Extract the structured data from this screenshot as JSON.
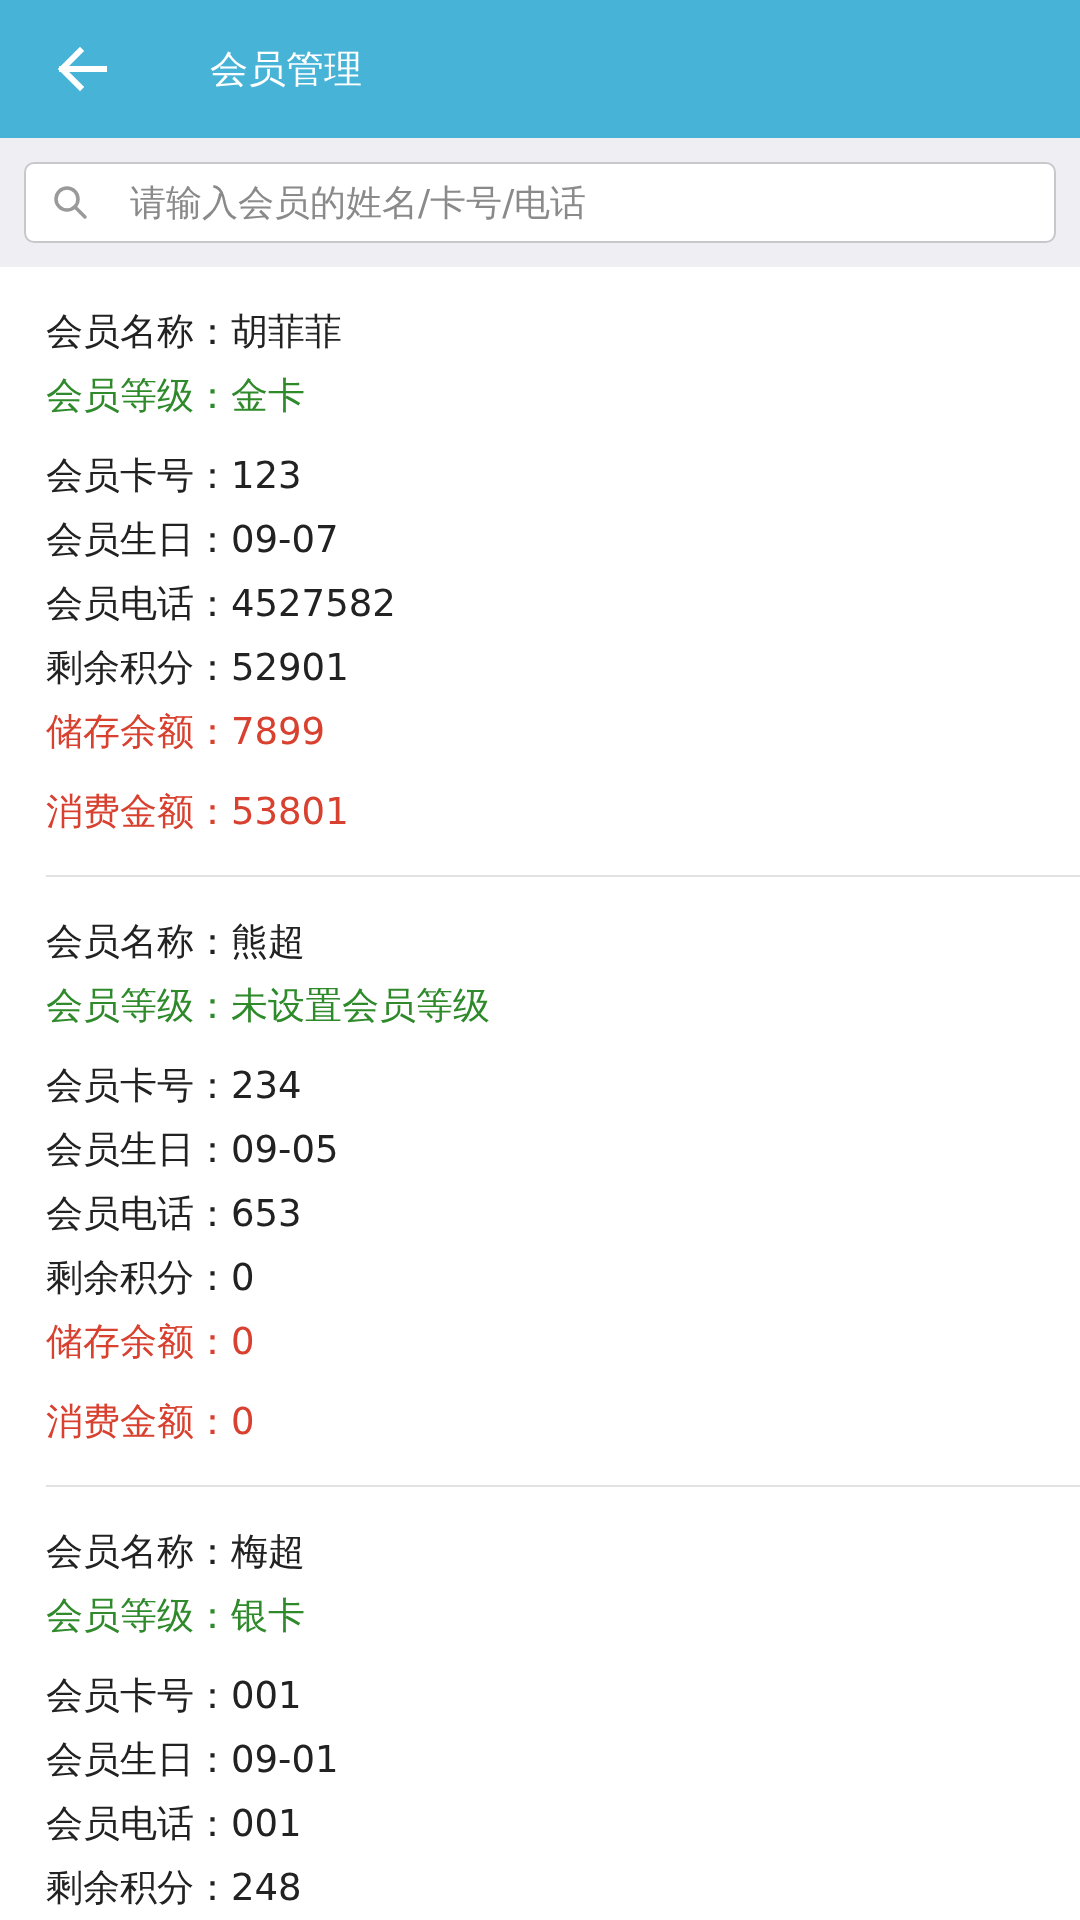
{
  "header": {
    "title": "会员管理"
  },
  "search": {
    "placeholder": "请输入会员的姓名/卡号/电话"
  },
  "members": [
    {
      "fields": [
        {
          "kind": "name",
          "label": "会员名称：",
          "value": "胡菲菲"
        },
        {
          "kind": "level",
          "label": "会员等级：",
          "value": "金卡"
        },
        {
          "kind": "info",
          "label": "会员卡号：",
          "value": "123"
        },
        {
          "kind": "info",
          "label": "会员生日：",
          "value": "09-07"
        },
        {
          "kind": "info",
          "label": "会员电话：",
          "value": "4527582"
        },
        {
          "kind": "info",
          "label": "剩余积分：",
          "value": "52901"
        },
        {
          "kind": "balance",
          "label": "储存余额：",
          "value": "7899"
        },
        {
          "kind": "spent",
          "label": "消费金额：",
          "value": "53801"
        }
      ]
    },
    {
      "fields": [
        {
          "kind": "name",
          "label": "会员名称：",
          "value": "熊超"
        },
        {
          "kind": "level",
          "label": "会员等级：",
          "value": "未设置会员等级"
        },
        {
          "kind": "info",
          "label": "会员卡号：",
          "value": "234"
        },
        {
          "kind": "info",
          "label": "会员生日：",
          "value": "09-05"
        },
        {
          "kind": "info",
          "label": "会员电话：",
          "value": "653"
        },
        {
          "kind": "info",
          "label": "剩余积分：",
          "value": "0"
        },
        {
          "kind": "balance",
          "label": "储存余额：",
          "value": "0"
        },
        {
          "kind": "spent",
          "label": "消费金额：",
          "value": "0"
        }
      ]
    },
    {
      "fields": [
        {
          "kind": "name",
          "label": "会员名称：",
          "value": "梅超"
        },
        {
          "kind": "level",
          "label": "会员等级：",
          "value": "银卡"
        },
        {
          "kind": "info",
          "label": "会员卡号：",
          "value": "001"
        },
        {
          "kind": "info",
          "label": "会员生日：",
          "value": "09-01"
        },
        {
          "kind": "info",
          "label": "会员电话：",
          "value": "001"
        },
        {
          "kind": "info",
          "label": "剩余积分：",
          "value": "248"
        }
      ]
    }
  ]
}
